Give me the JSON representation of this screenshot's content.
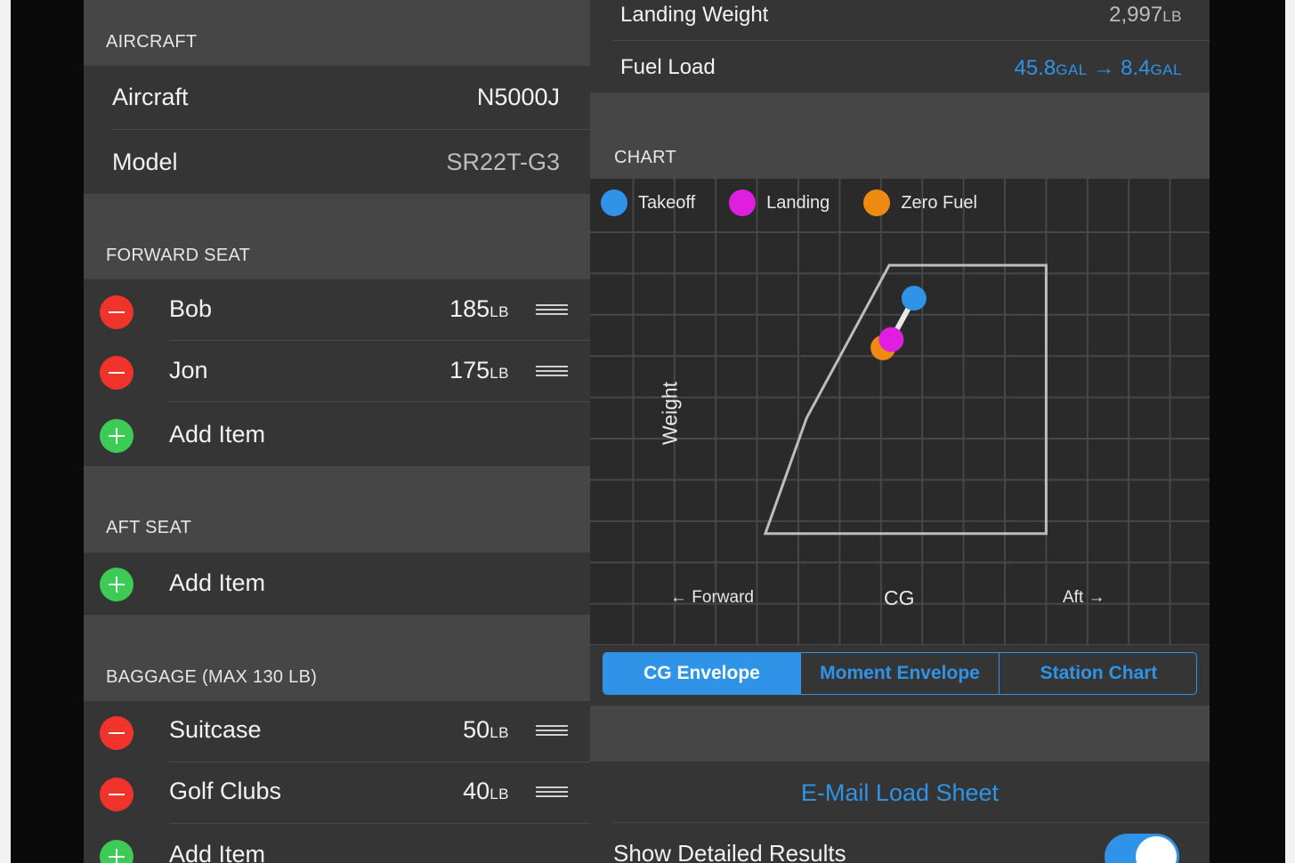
{
  "aircraft_section": {
    "header": "AIRCRAFT",
    "rows": [
      {
        "label": "Aircraft",
        "value": "N5000J"
      },
      {
        "label": "Model",
        "value": "SR22T-G3"
      }
    ]
  },
  "forward_seat": {
    "header": "FORWARD SEAT",
    "items": [
      {
        "name": "Bob",
        "weight": "185",
        "unit": "LB"
      },
      {
        "name": "Jon",
        "weight": "175",
        "unit": "LB"
      }
    ],
    "add_label": "Add Item"
  },
  "aft_seat": {
    "header": "AFT SEAT",
    "add_label": "Add Item"
  },
  "baggage": {
    "header": "BAGGAGE (MAX 130 LB)",
    "items": [
      {
        "name": "Suitcase",
        "weight": "50",
        "unit": "LB"
      },
      {
        "name": "Golf Clubs",
        "weight": "40",
        "unit": "LB"
      }
    ],
    "add_label": "Add Item"
  },
  "results": {
    "landing_weight": {
      "label": "Landing Weight",
      "value": "2,997",
      "unit": "LB"
    },
    "fuel_load": {
      "label": "Fuel Load",
      "from": "45.8",
      "to": "8.4",
      "unit": "GAL",
      "arrow": "→"
    }
  },
  "chart": {
    "header": "CHART",
    "legend": [
      {
        "label": "Takeoff",
        "color": "#2f93e8"
      },
      {
        "label": "Landing",
        "color": "#e01ee0"
      },
      {
        "label": "Zero Fuel",
        "color": "#ee8a12"
      }
    ],
    "ylabel": "Weight",
    "xlabel": "CG",
    "left_label": "← Forward",
    "right_label": "Aft →"
  },
  "chart_data": {
    "type": "scatter",
    "title": "",
    "xlabel": "CG",
    "ylabel": "Weight",
    "xlim": [
      0,
      15
    ],
    "ylim": [
      0,
      9
    ],
    "grid": true,
    "envelope": [
      [
        4.2,
        2.2
      ],
      [
        5.2,
        5.0
      ],
      [
        7.2,
        8.7
      ],
      [
        11.0,
        8.7
      ],
      [
        11.0,
        2.2
      ]
    ],
    "series": [
      {
        "name": "Takeoff",
        "x": [
          7.8
        ],
        "y": [
          7.9
        ]
      },
      {
        "name": "Landing",
        "x": [
          7.25
        ],
        "y": [
          6.9
        ]
      },
      {
        "name": "Zero Fuel",
        "x": [
          7.05
        ],
        "y": [
          6.7
        ]
      }
    ]
  },
  "segments": [
    {
      "label": "CG Envelope",
      "active": true
    },
    {
      "label": "Moment Envelope",
      "active": false
    },
    {
      "label": "Station Chart",
      "active": false
    }
  ],
  "email_label": "E-Mail Load Sheet",
  "detailed": {
    "label": "Show Detailed Results",
    "enabled": true
  }
}
